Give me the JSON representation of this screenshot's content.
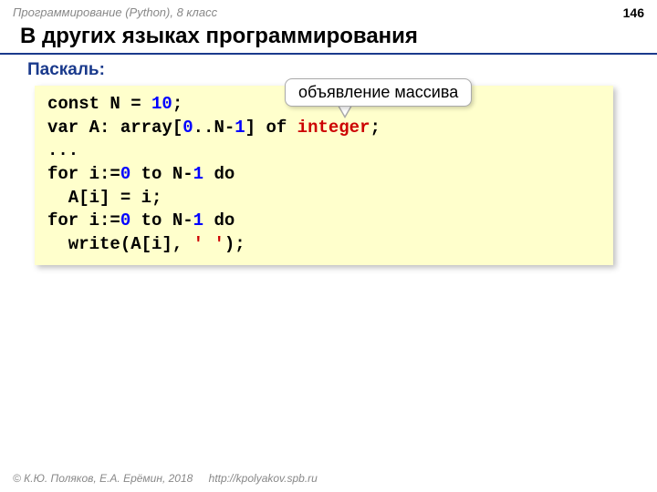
{
  "header": {
    "course": "Программирование (Python), 8 класс",
    "page_number": "146"
  },
  "title": "В других языках программирования",
  "subheader": "Паскаль:",
  "callout": "объявление массива",
  "code": {
    "l1": {
      "a": "const N = ",
      "n1": "10",
      "b": ";"
    },
    "l2": {
      "a": "var A: array[",
      "n1": "0",
      "b": "..N-",
      "n2": "1",
      "c": "] of ",
      "typ": "integer",
      "d": ";"
    },
    "l3": {
      "a": "..."
    },
    "l4": {
      "a": "for i:=",
      "n1": "0",
      "b": " to N-",
      "n2": "1",
      "c": " do"
    },
    "l5": {
      "a": "  A[i] = i;"
    },
    "l6": {
      "a": "for i:=",
      "n1": "0",
      "b": " to N-",
      "n2": "1",
      "c": " do"
    },
    "l7": {
      "a": "  write(A[i], ",
      "s": "' '",
      "b": ");"
    }
  },
  "footer": {
    "copyright": "© К.Ю. Поляков, Е.А. Ерёмин, 2018",
    "url": "http://kpolyakov.spb.ru"
  }
}
